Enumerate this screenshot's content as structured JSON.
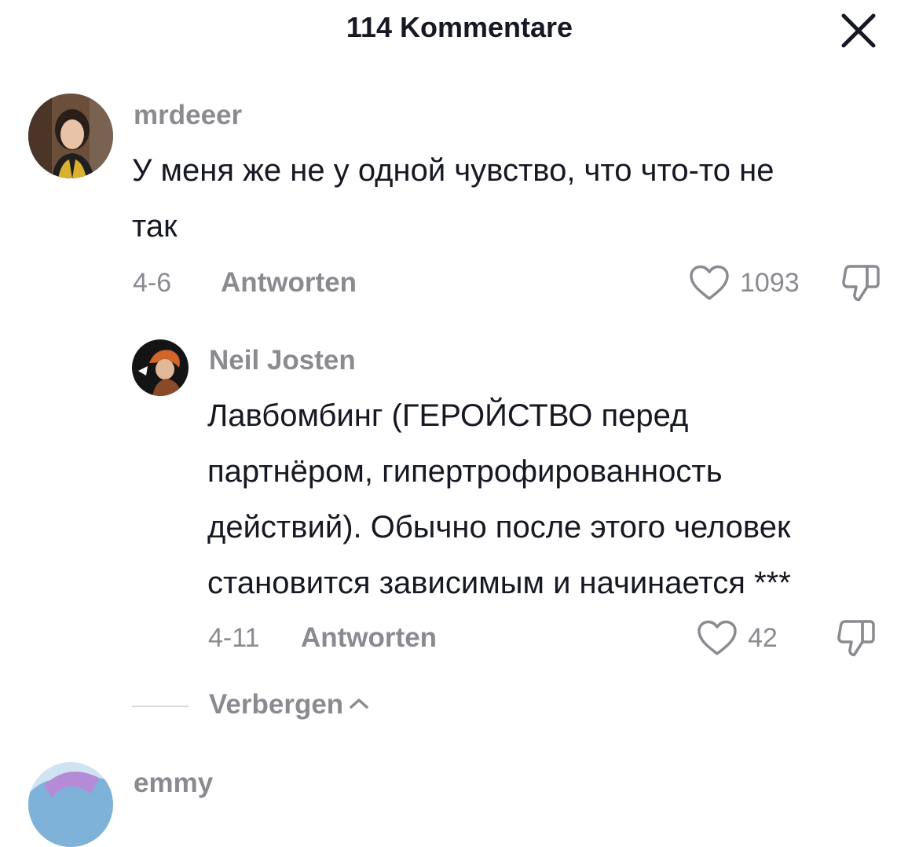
{
  "header": {
    "title": "114 Kommentare",
    "close_icon": "close-icon"
  },
  "comments": [
    {
      "username": "mrdeeer",
      "text_lines": [
        "У меня же не у одной чувство, что что-то не",
        "так"
      ],
      "date": "4-6",
      "reply_label": "Antworten",
      "like_count": "1093",
      "avatar_icon": "user-avatar"
    }
  ],
  "replies": [
    {
      "username": "Neil Josten",
      "text_lines": [
        "Лавбомбинг (ГЕРОЙСТВО перед",
        "партнёром, гипертрофированность",
        "действий). Обычно после этого человек",
        "становится зависимым и начинается ***"
      ],
      "date": "4-11",
      "reply_label": "Antworten",
      "like_count": "42",
      "avatar_icon": "user-avatar"
    }
  ],
  "hide_replies": {
    "label": "Verbergen",
    "icon": "chevron-up-icon"
  },
  "next_comment": {
    "username": "emmy"
  },
  "colors": {
    "text": "#161823",
    "secondary": "#8a8b91",
    "divider": "#d8d8da"
  }
}
